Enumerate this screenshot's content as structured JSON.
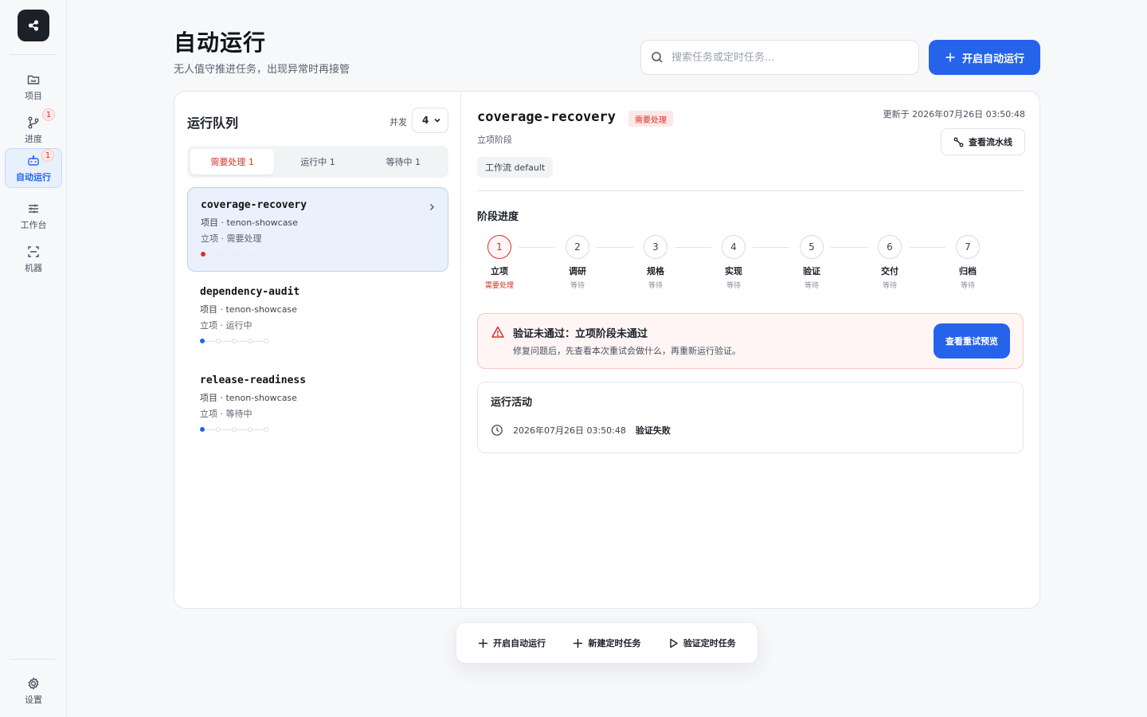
{
  "sidebar": {
    "logo_icon": "share-icon",
    "items": [
      {
        "label": "项目",
        "icon": "folder-icon",
        "badge": ""
      },
      {
        "label": "进度",
        "icon": "branch-icon",
        "badge": "1"
      },
      {
        "label": "自动运行",
        "icon": "robot-icon",
        "badge": "1"
      },
      {
        "label": "工作台",
        "icon": "sliders-icon",
        "badge": ""
      },
      {
        "label": "机器",
        "icon": "scan-icon",
        "badge": ""
      }
    ],
    "settings_label": "设置"
  },
  "header": {
    "title": "自动运行",
    "subtitle": "无人值守推进任务，出现异常时再接管",
    "search_placeholder": "搜索任务或定时任务...",
    "primary_button": "开启自动运行"
  },
  "queue": {
    "title": "运行队列",
    "concurrency_label": "并发",
    "concurrency_value": "4",
    "tabs": [
      {
        "label": "需要处理 1",
        "active": true
      },
      {
        "label": "运行中 1",
        "active": false
      },
      {
        "label": "等待中 1",
        "active": false
      }
    ],
    "items": [
      {
        "name": "coverage-recovery",
        "project": "项目 · tenon-showcase",
        "state": "立项 · 需要处理"
      },
      {
        "name": "dependency-audit",
        "project": "项目 · tenon-showcase",
        "state": "立项 · 运行中"
      },
      {
        "name": "release-readiness",
        "project": "项目 · tenon-showcase",
        "state": "立项 · 等待中"
      }
    ]
  },
  "detail": {
    "name": "coverage-recovery",
    "badge": "需要处理",
    "updated": "更新于 2026年07月26日 03:50:48",
    "stage_label": "立项阶段",
    "pipeline_button": "查看流水线",
    "workflow_chip": "工作流 default",
    "progress_title": "阶段进度",
    "stages": [
      {
        "num": "1",
        "name": "立项",
        "status": "需要处理"
      },
      {
        "num": "2",
        "name": "调研",
        "status": "等待"
      },
      {
        "num": "3",
        "name": "规格",
        "status": "等待"
      },
      {
        "num": "4",
        "name": "实现",
        "status": "等待"
      },
      {
        "num": "5",
        "name": "验证",
        "status": "等待"
      },
      {
        "num": "6",
        "name": "交付",
        "status": "等待"
      },
      {
        "num": "7",
        "name": "归档",
        "status": "等待"
      }
    ],
    "alert": {
      "title": "验证未通过：立项阶段未通过",
      "desc": "修复问题后，先查看本次重试会做什么，再重新运行验证。",
      "button": "查看重试预览"
    },
    "activity": {
      "title": "运行活动",
      "time": "2026年07月26日 03:50:48",
      "event": "验证失败"
    }
  },
  "action_bar": {
    "start": "开启自动运行",
    "new_schedule": "新建定时任务",
    "verify_schedule": "验证定时任务"
  },
  "colors": {
    "accent": "#2563eb",
    "danger": "#d93025",
    "dark": "#1c2128"
  }
}
